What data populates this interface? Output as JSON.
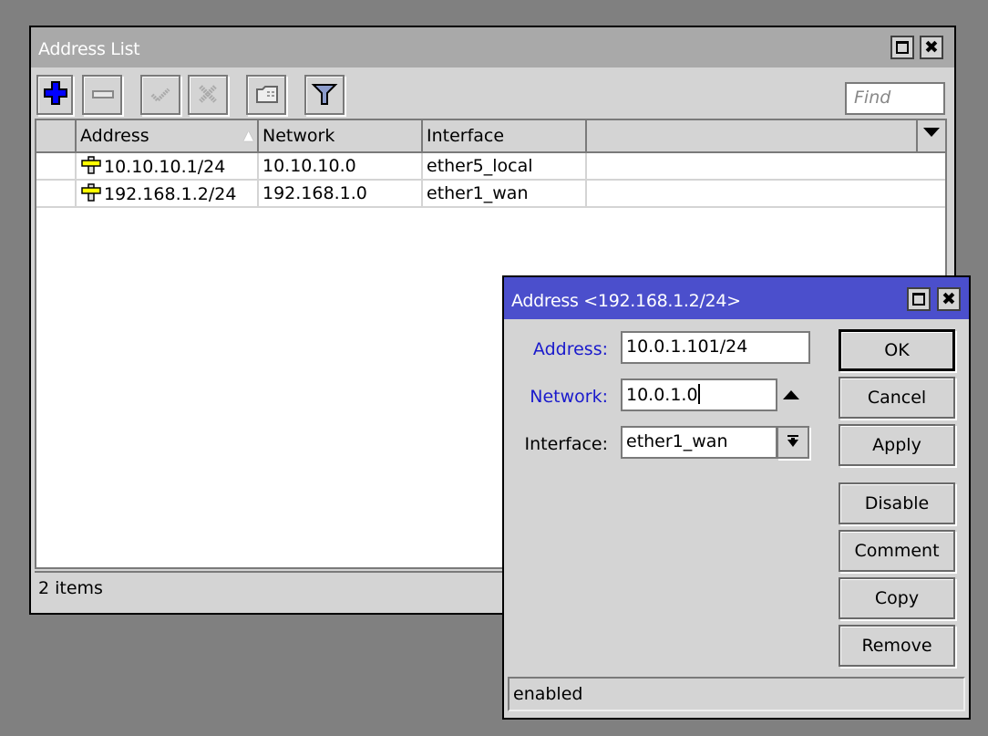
{
  "main_window": {
    "title": "Address List",
    "toolbar": [
      {
        "name": "add",
        "icon": "plus-icon",
        "enabled": true
      },
      {
        "name": "remove",
        "icon": "minus-icon",
        "enabled": true
      },
      {
        "name": "enable",
        "icon": "check-icon",
        "enabled": false
      },
      {
        "name": "disable",
        "icon": "cross-icon",
        "enabled": false
      },
      {
        "name": "comment",
        "icon": "comment-icon",
        "enabled": true
      },
      {
        "name": "filter",
        "icon": "filter-icon",
        "enabled": true
      }
    ],
    "find_placeholder": "Find",
    "columns": [
      "Address",
      "Network",
      "Interface"
    ],
    "sort_column": "Address",
    "rows": [
      {
        "address": "10.10.10.1/24",
        "network": "10.10.10.0",
        "interface": "ether5_local"
      },
      {
        "address": "192.168.1.2/24",
        "network": "192.168.1.0",
        "interface": "ether1_wan"
      }
    ],
    "status": "2 items"
  },
  "dialog": {
    "title": "Address <192.168.1.2/24>",
    "fields": {
      "address": {
        "label": "Address:",
        "value": "10.0.1.101/24"
      },
      "network": {
        "label": "Network:",
        "value": "10.0.1.0"
      },
      "interface": {
        "label": "Interface:",
        "value": "ether1_wan"
      }
    },
    "buttons": {
      "ok": "OK",
      "cancel": "Cancel",
      "apply": "Apply",
      "disable": "Disable",
      "comment": "Comment",
      "copy": "Copy",
      "remove": "Remove"
    },
    "status": "enabled"
  },
  "colors": {
    "dialog_title_bg": "#4b4fcc",
    "inactive_title_bg": "#a9a9a9",
    "field_label_blue": "#1a1acc"
  }
}
